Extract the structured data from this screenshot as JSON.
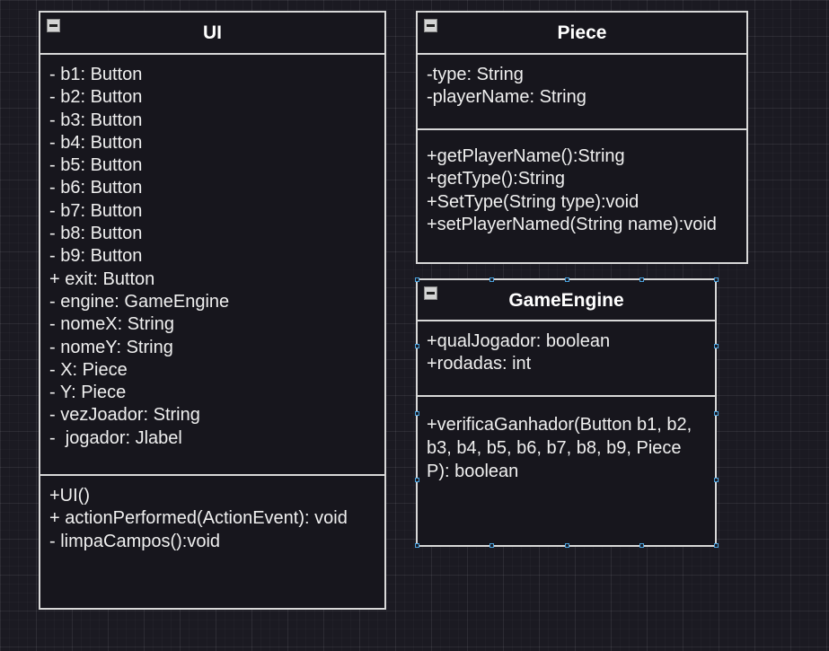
{
  "classes": {
    "ui": {
      "name": "UI",
      "attributes": [
        "- b1: Button",
        "- b2: Button",
        "- b3: Button",
        "- b4: Button",
        "- b5: Button",
        "- b6: Button",
        "- b7: Button",
        "- b8: Button",
        "- b9: Button",
        "+ exit: Button",
        "- engine: GameEngine",
        "- nomeX: String",
        "- nomeY: String",
        "- X: Piece",
        "- Y: Piece",
        "- vezJoador: String",
        "-  jogador: Jlabel"
      ],
      "methods": [
        "+UI()",
        "+ actionPerformed(ActionEvent): void",
        "- limpaCampos():void"
      ]
    },
    "piece": {
      "name": "Piece",
      "attributes": [
        "-type: String",
        "-playerName: String"
      ],
      "methods": [
        "+getPlayerName():String",
        "+getType():String",
        "+SetType(String type):void",
        "+setPlayerNamed(String name):void"
      ]
    },
    "game_engine": {
      "name": "GameEngine",
      "attributes": [
        "+qualJogador: boolean",
        "+rodadas: int"
      ],
      "methods": [
        "+verificaGanhador(Button b1, b2, b3, b4, b5, b6, b7, b8, b9, Piece P): boolean"
      ]
    }
  },
  "colors": {
    "background": "#1b1a22",
    "border": "#d8d8d8",
    "text": "#f0f0f0",
    "selection_handle": "#4aa3df"
  },
  "icons": {
    "collapse": "minus-box-icon"
  }
}
